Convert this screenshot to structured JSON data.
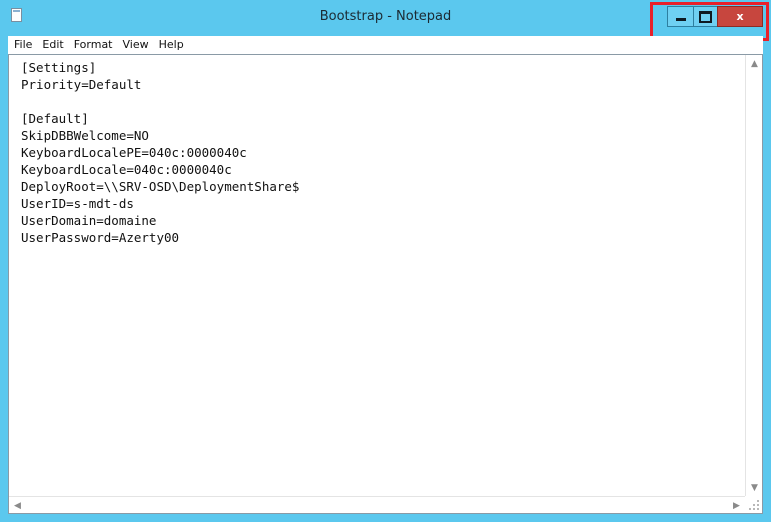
{
  "window": {
    "title": "Bootstrap - Notepad",
    "close_label": "x"
  },
  "menu": {
    "items": [
      "File",
      "Edit",
      "Format",
      "View",
      "Help"
    ]
  },
  "document": {
    "lines": [
      "[Settings]",
      "Priority=Default",
      "",
      "[Default]",
      "SkipDBBWelcome=NO",
      "KeyboardLocalePE=040c:0000040c",
      "KeyboardLocale=040c:0000040c",
      "DeployRoot=\\\\SRV-OSD\\DeploymentShare$",
      "UserID=s-mdt-ds",
      "UserDomain=domaine",
      "UserPassword=Azerty00"
    ]
  },
  "icons": {
    "app": "notepad-icon",
    "minimize": "minimize-icon",
    "maximize": "maximize-icon",
    "close": "close-icon",
    "scroll_up": "chevron-up-icon",
    "scroll_down": "chevron-down-icon",
    "scroll_left": "chevron-left-icon",
    "scroll_right": "chevron-right-icon"
  },
  "colors": {
    "frame": "#5bc8ee",
    "close_button": "#c7463e",
    "highlight": "#e8202a"
  }
}
